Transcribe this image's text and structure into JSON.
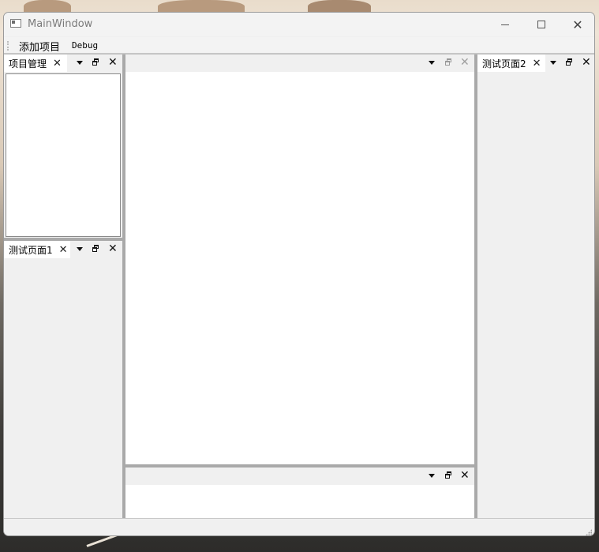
{
  "window": {
    "title": "MainWindow"
  },
  "window_controls": {
    "minimize": "minimize",
    "maximize": "maximize",
    "close": "✕"
  },
  "menubar": {
    "items": [
      {
        "label": "添加项目"
      },
      {
        "label": "Debug"
      }
    ]
  },
  "docks": {
    "project": {
      "tab_label": "项目管理",
      "tab_close": "✕",
      "close": "✕"
    },
    "test1": {
      "tab_label": "测试页面1",
      "tab_close": "✕",
      "close": "✕"
    },
    "center": {
      "close": "✕"
    },
    "bottom": {
      "close": "✕"
    },
    "test2": {
      "tab_label": "测试页面2",
      "tab_close": "✕",
      "close": "✕"
    }
  },
  "icons": [
    "app-icon",
    "dropdown-icon",
    "float-icon",
    "close-icon",
    "size-grip-icon"
  ]
}
